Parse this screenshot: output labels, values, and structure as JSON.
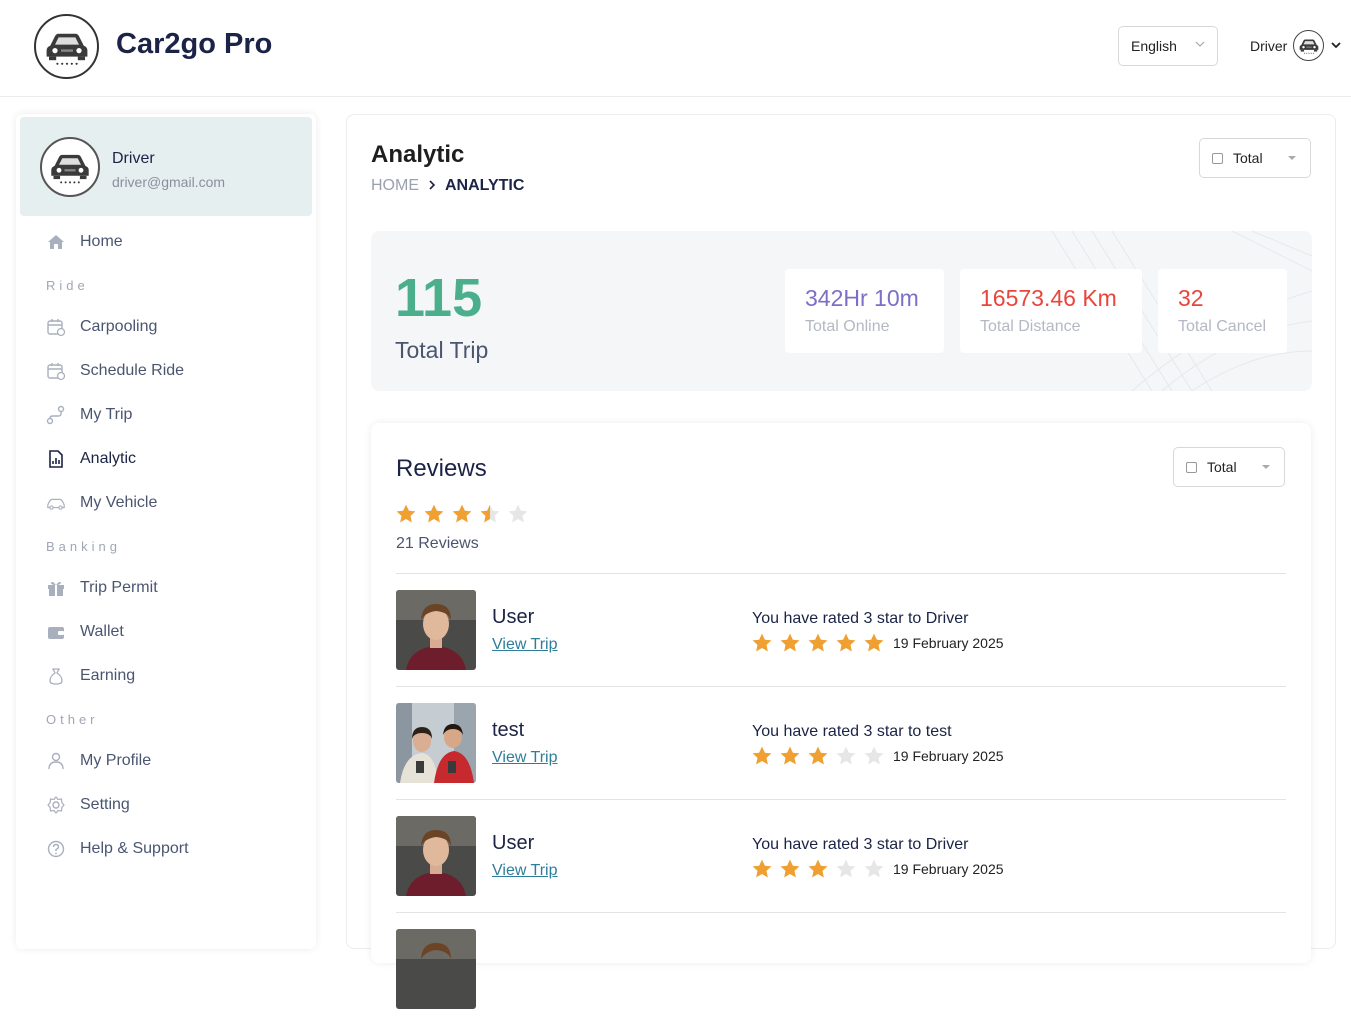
{
  "header": {
    "brand": "Car2go Pro",
    "language": "English",
    "user_label": "Driver"
  },
  "sidebar": {
    "profile": {
      "name": "Driver",
      "email": "driver@gmail.com"
    },
    "items": {
      "home": "Home",
      "section_ride": "Ride",
      "carpooling": "Carpooling",
      "schedule_ride": "Schedule Ride",
      "my_trip": "My Trip",
      "analytic": "Analytic",
      "my_vehicle": "My Vehicle",
      "section_banking": "Banking",
      "trip_permit": "Trip Permit",
      "wallet": "Wallet",
      "earning": "Earning",
      "section_other": "Other",
      "my_profile": "My Profile",
      "setting": "Setting",
      "help_support": "Help & Support"
    }
  },
  "main": {
    "title": "Analytic",
    "breadcrumb": {
      "home": "HOME",
      "current": "ANALYTIC"
    },
    "filter": "Total",
    "stats": {
      "total_trip_value": "115",
      "total_trip_label": "Total Trip",
      "online_value": "342Hr 10m",
      "online_label": "Total Online",
      "distance_value": "16573.46 Km",
      "distance_label": "Total Distance",
      "cancel_value": "32",
      "cancel_label": "Total Cancel"
    },
    "colors": {
      "trip": "#4caf8c",
      "online": "#7b6fc8",
      "distance": "#e8453c",
      "cancel": "#e8453c",
      "star": "#f0a030",
      "star_empty": "#e6e6e6"
    },
    "reviews": {
      "title": "Reviews",
      "filter": "Total",
      "overall_rating": 3.5,
      "count_label": "21 Reviews",
      "list": [
        {
          "name": "User",
          "link": "View Trip",
          "text": "You have rated 3 star to Driver",
          "stars": 5,
          "date": "19 February 2025"
        },
        {
          "name": "test",
          "link": "View Trip",
          "text": "You have rated 3 star to test",
          "stars": 3,
          "date": "19 February 2025"
        },
        {
          "name": "User",
          "link": "View Trip",
          "text": "You have rated 3 star to Driver",
          "stars": 3,
          "date": "19 February 2025"
        }
      ]
    }
  }
}
